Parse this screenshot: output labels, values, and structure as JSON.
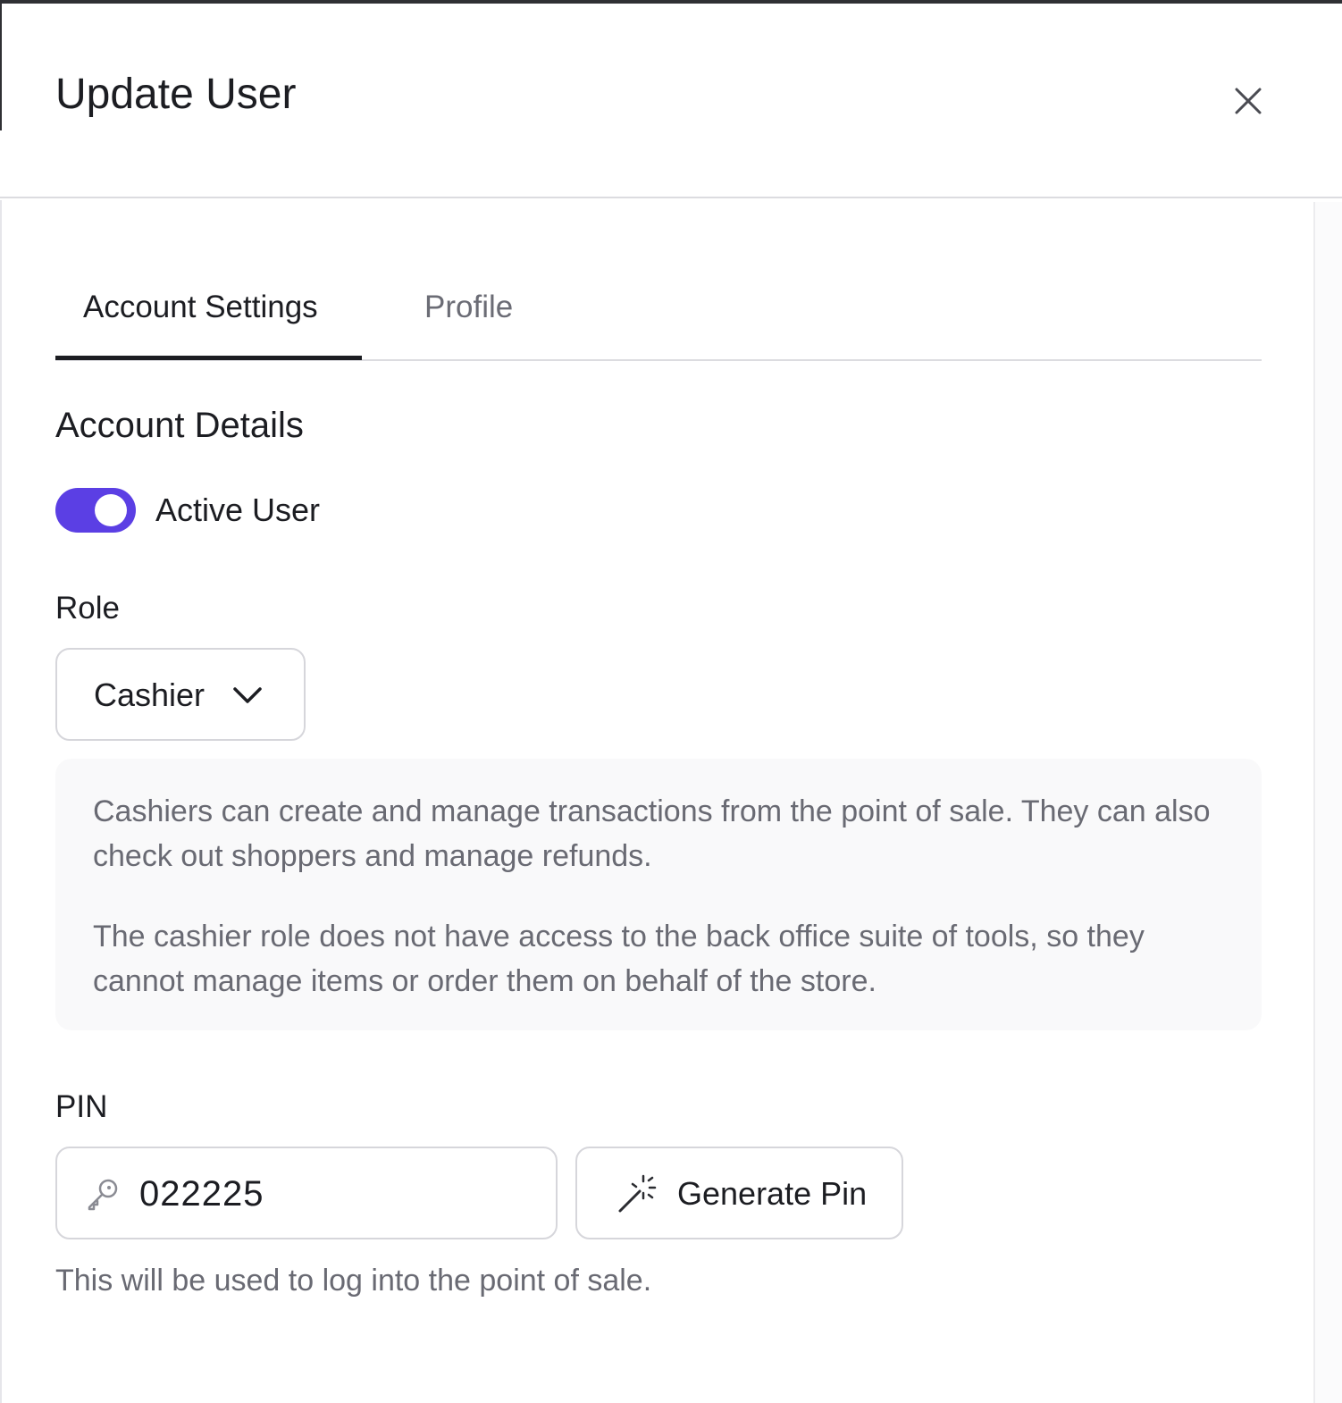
{
  "dialog": {
    "title": "Update User",
    "close_icon": "close-icon"
  },
  "tabs": [
    {
      "label": "Account Settings",
      "active": true
    },
    {
      "label": "Profile",
      "active": false
    }
  ],
  "account_details": {
    "heading": "Account Details",
    "active_toggle": {
      "label": "Active User",
      "checked": true,
      "color": "#5b3fe4"
    }
  },
  "role": {
    "label": "Role",
    "selected": "Cashier",
    "chevron_icon": "chevron-down-icon",
    "description": [
      "Cashiers can create and manage transactions from the point of sale. They can also check out shoppers and manage refunds.",
      "The cashier role does not have access to the back office suite of tools, so they cannot manage items or order them on behalf of the store."
    ]
  },
  "pin": {
    "label": "PIN",
    "value": "022225",
    "key_icon": "key-icon",
    "generate_button": {
      "label": "Generate Pin",
      "icon": "magic-wand-icon"
    },
    "hint": "This will be used to log into the point of sale."
  }
}
